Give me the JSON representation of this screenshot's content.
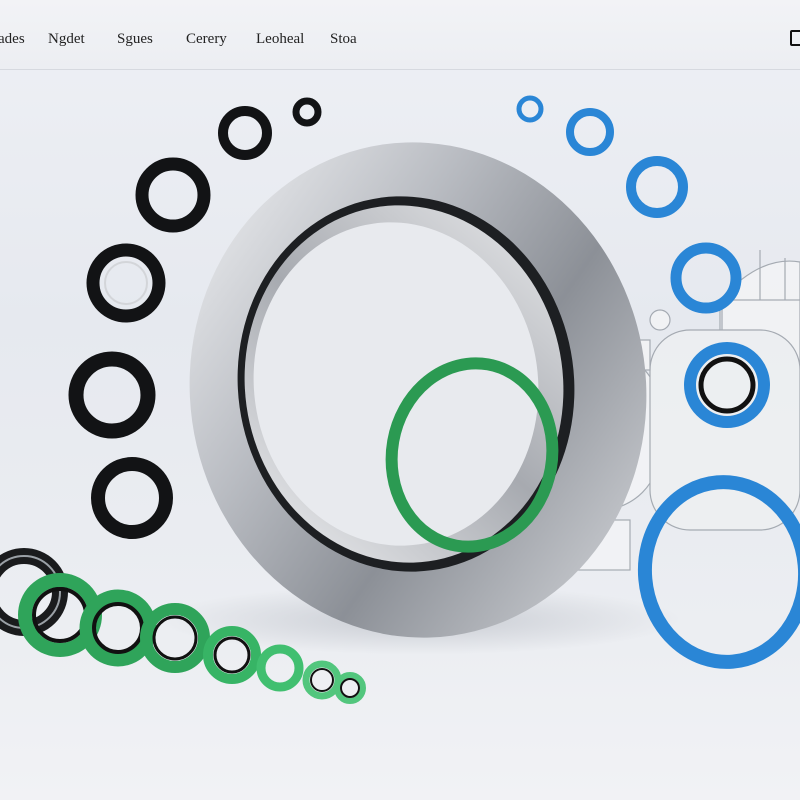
{
  "nav": {
    "items": [
      {
        "label": "ades"
      },
      {
        "label": "Ngdet"
      },
      {
        "label": "Sgues"
      },
      {
        "label": "Cerery"
      },
      {
        "label": "Leoheal"
      },
      {
        "label": "Stoa"
      }
    ],
    "right_icon": "cart-icon"
  },
  "hero": {
    "description": "product hero showing seals and o-rings",
    "colors": {
      "black_seal": "#111111",
      "blue_ring": "#2a86d6",
      "green_ring": "#2fa45a",
      "steel": "#b9bcc2",
      "background": "#e8eaef"
    }
  }
}
